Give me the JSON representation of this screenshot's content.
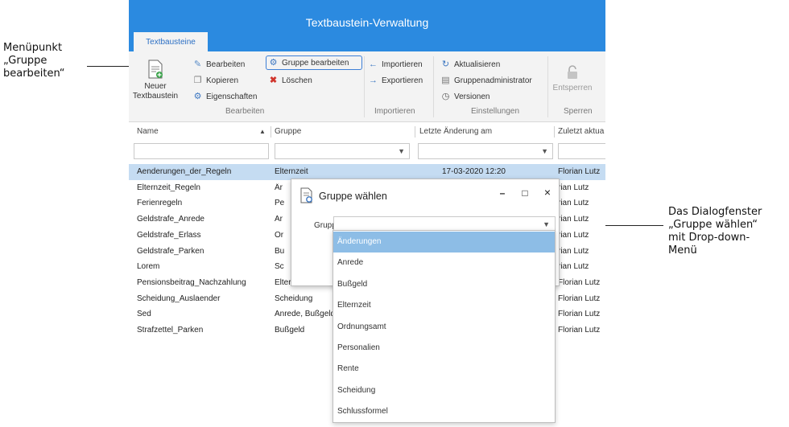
{
  "annotations": {
    "left": "Menüpunkt\n„Gruppe\nbearbeiten“",
    "right": "Das Dialogfenster\n„Gruppe wählen“\nmit Drop-down-\nMenü"
  },
  "window": {
    "title": "Textbaustein-Verwaltung",
    "tab": "Textbausteine"
  },
  "ribbon": {
    "new_label_1": "Neuer",
    "new_label_2": "Textbaustein",
    "edit": "Bearbeiten",
    "copy": "Kopieren",
    "properties": "Eigenschaften",
    "edit_group": "Gruppe bearbeiten",
    "delete": "Löschen",
    "group_edit": "Bearbeiten",
    "import": "Importieren",
    "export": "Exportieren",
    "group_import": "Importieren",
    "refresh": "Aktualisieren",
    "group_admin": "Gruppenadministrator",
    "versions": "Versionen",
    "group_settings": "Einstellungen",
    "unlock": "Entsperren",
    "group_lock": "Sperren"
  },
  "table": {
    "columns": [
      "Name",
      "Gruppe",
      "Letzte Änderung am",
      "Zuletzt aktua"
    ],
    "rows": [
      [
        "Aenderungen_der_Regeln",
        "Elternzeit",
        "17-03-2020 12:20",
        "Florian Lutz"
      ],
      [
        "Elternzeit_Regeln",
        "Är",
        "",
        "rian Lutz"
      ],
      [
        "Ferienregeln",
        "Pe",
        "",
        "rian Lutz"
      ],
      [
        "Geldstrafe_Anrede",
        "Ar",
        "",
        "rian Lutz"
      ],
      [
        "Geldstrafe_Erlass",
        "Or",
        "",
        "rian Lutz"
      ],
      [
        "Geldstrafe_Parken",
        "Bu",
        "",
        "rian Lutz"
      ],
      [
        "Lorem",
        "Sc",
        "",
        "rian Lutz"
      ],
      [
        "Pensionsbeitrag_Nachzahlung",
        "Elternzeit, Rente",
        "",
        "Florian Lutz"
      ],
      [
        "Scheidung_Auslaender",
        "Scheidung",
        "",
        "Florian Lutz"
      ],
      [
        "Sed",
        "Anrede, Bußgeld",
        "",
        "Florian Lutz"
      ],
      [
        "Strafzettel_Parken",
        "Bußgeld",
        "",
        "Florian Lutz"
      ]
    ]
  },
  "dialog": {
    "title": "Gruppe wählen",
    "group_label": "Gruppe:",
    "minimize": "–",
    "maximize": "□",
    "close": "×",
    "options": [
      "Änderungen",
      "Anrede",
      "Bußgeld",
      "Elternzeit",
      "Ordnungsamt",
      "Personalien",
      "Rente",
      "Scheidung",
      "Schlussformel"
    ],
    "highlighted_index": 0
  },
  "colors": {
    "accent": "#2b8ae0",
    "selection": "#c5dcf2",
    "dropdown_highlight": "#8dbde6"
  }
}
